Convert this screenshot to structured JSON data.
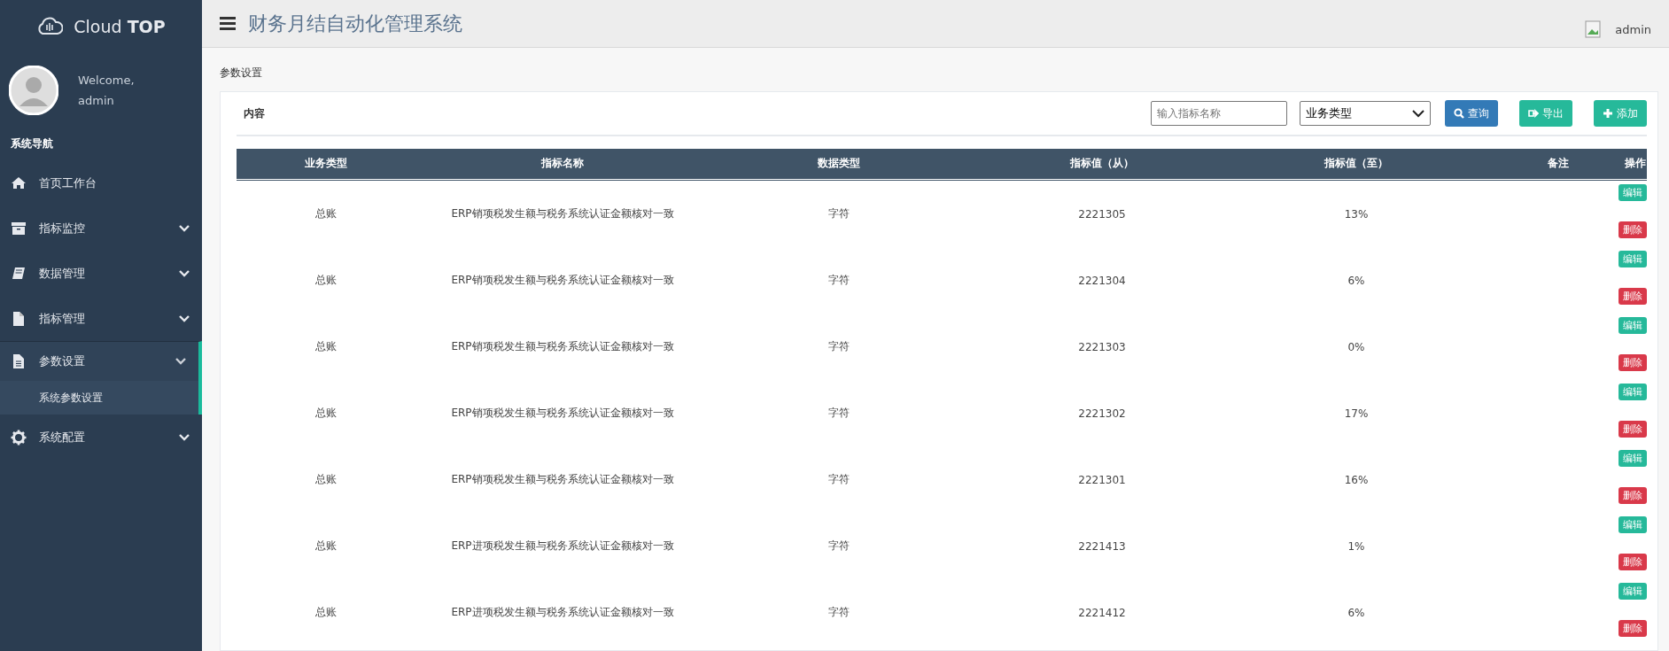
{
  "sidebar": {
    "logo": {
      "text": "Cloud",
      "bold": "TOP"
    },
    "user": {
      "welcome": "Welcome,",
      "name": "admin"
    },
    "nav_title": "系统导航",
    "items": [
      {
        "kind": "home",
        "label": "首页工作台",
        "selected": false
      },
      {
        "kind": "archive",
        "label": "指标监控",
        "expanded": false,
        "selected": false
      },
      {
        "kind": "book",
        "label": "数据管理",
        "expanded": false,
        "selected": false
      },
      {
        "kind": "file",
        "label": "指标管理",
        "expanded": false,
        "selected": false
      },
      {
        "kind": "doc",
        "label": "参数设置",
        "expanded": true,
        "selected": true,
        "children": [
          {
            "label": "系统参数设置",
            "selected": true
          }
        ]
      },
      {
        "kind": "gear",
        "label": "系统配置",
        "expanded": false,
        "selected": false
      }
    ]
  },
  "header": {
    "title": "财务月结自动化管理系统",
    "user": "admin"
  },
  "breadcrumb": "参数设置",
  "panel": {
    "title": "内容",
    "search": {
      "placeholder": "输入指标名称"
    },
    "filter": {
      "value": "业务类型"
    },
    "buttons": [
      {
        "kind": "search",
        "label": "查询"
      },
      {
        "kind": "export",
        "label": "导出"
      },
      {
        "kind": "add",
        "label": "添加"
      }
    ]
  },
  "table": {
    "columns": [
      "业务类型",
      "指标名称",
      "数据类型",
      "指标值（从）",
      "指标值（至）",
      "备注",
      "操作"
    ],
    "rows": [
      {
        "cells": [
          "总账",
          "ERP销项税发生额与税务系统认证金额核对一致",
          "字符",
          "2221305",
          "13%"
        ],
        "actions": [
          "编辑",
          "删除"
        ]
      },
      {
        "cells": [
          "总账",
          "ERP销项税发生额与税务系统认证金额核对一致",
          "字符",
          "2221304",
          "6%"
        ],
        "actions": [
          "编辑",
          "删除"
        ]
      },
      {
        "cells": [
          "总账",
          "ERP销项税发生额与税务系统认证金额核对一致",
          "字符",
          "2221303",
          "0%"
        ],
        "actions": [
          "编辑",
          "删除"
        ]
      },
      {
        "cells": [
          "总账",
          "ERP销项税发生额与税务系统认证金额核对一致",
          "字符",
          "2221302",
          "17%"
        ],
        "actions": [
          "编辑",
          "删除"
        ]
      },
      {
        "cells": [
          "总账",
          "ERP销项税发生额与税务系统认证金额核对一致",
          "字符",
          "2221301",
          "16%"
        ],
        "actions": [
          "编辑",
          "删除"
        ]
      },
      {
        "cells": [
          "总账",
          "ERP进项税发生额与税务系统认证金额核对一致",
          "字符",
          "2221413",
          "1%"
        ],
        "actions": [
          "编辑",
          "删除"
        ]
      },
      {
        "cells": [
          "总账",
          "ERP进项税发生额与税务系统认证金额核对一致",
          "字符",
          "2221412",
          "6%"
        ],
        "actions": [
          "编辑",
          "删除"
        ]
      }
    ]
  }
}
